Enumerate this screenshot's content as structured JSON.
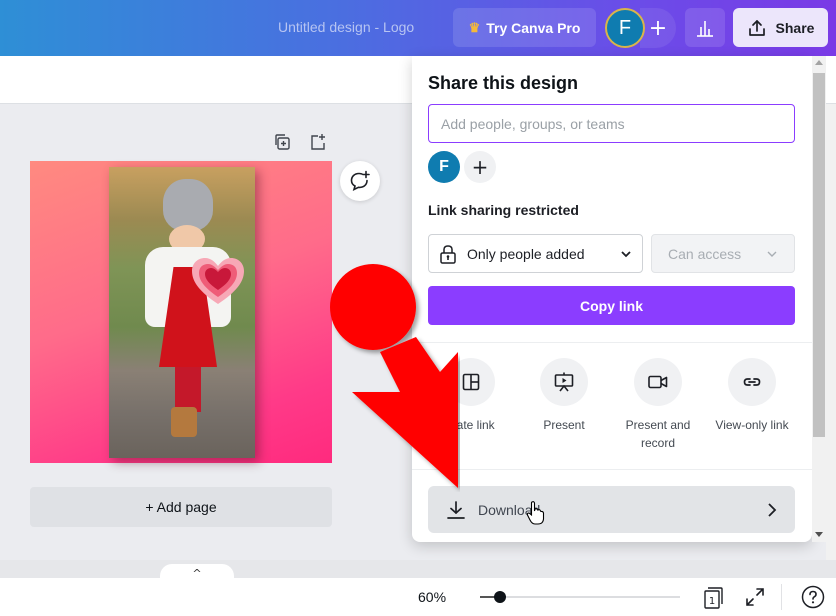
{
  "header": {
    "doc_title": "Untitled design - Logo",
    "try_pro_label": "Try Canva Pro",
    "user_initial": "F",
    "add_collaborator": "+",
    "share_label": "Share",
    "colors": {
      "brand_purple": "#8b3dff",
      "avatar_blue": "#0f7cb0"
    }
  },
  "canvas": {
    "add_page_label": "+ Add page",
    "pages_toggle": "^"
  },
  "share_panel": {
    "title": "Share this design",
    "people_input_placeholder": "Add people, groups, or teams",
    "people_input_value": "",
    "members": [
      {
        "initial": "F"
      }
    ],
    "add_member": "+",
    "link_sharing_label": "Link sharing restricted",
    "access_select": {
      "value": "Only people added",
      "icon": "lock-icon"
    },
    "permission_select": {
      "value": "Can access",
      "disabled": true
    },
    "copy_link_label": "Copy link",
    "options": [
      {
        "label": "plate link",
        "icon": "template-icon"
      },
      {
        "label": "Present",
        "icon": "present-icon"
      },
      {
        "label": "Present and record",
        "icon": "video-camera-icon"
      },
      {
        "label": "View-only link",
        "icon": "link-icon"
      }
    ],
    "download_label": "Download"
  },
  "footer": {
    "zoom_level": "60%",
    "zoom_fraction": 0.1,
    "page_number": "1"
  }
}
